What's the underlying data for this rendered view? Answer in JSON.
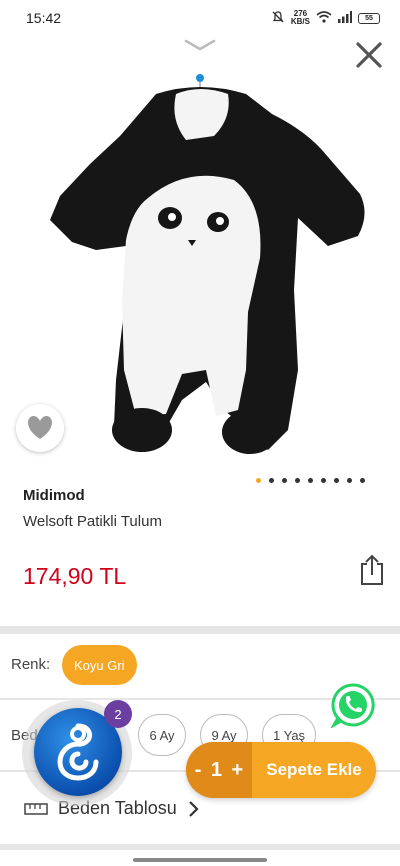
{
  "status_bar": {
    "time": "15:42",
    "net_speed_value": "276",
    "net_speed_unit": "KB/S",
    "battery": "55"
  },
  "product": {
    "brand": "Midimod",
    "name": "Welsoft Patikli Tulum",
    "price": "174,90 TL",
    "image_count": 9,
    "active_image_index": 0
  },
  "options": {
    "color_label": "Renk:",
    "color_value": "Koyu Gri",
    "size_label": "Beden:",
    "sizes": [
      "6 Ay",
      "9 Ay",
      "1 Yaş"
    ]
  },
  "size_table": {
    "label": "Beden Tablosu"
  },
  "cart": {
    "minus": "-",
    "quantity": "1",
    "plus": "+",
    "add_label": "Sepete Ekle"
  },
  "chat": {
    "badge_count": "2"
  },
  "colors": {
    "accent": "#f5a623",
    "accent_dark": "#e08a1a",
    "price": "#d0021b",
    "whatsapp": "#25d366",
    "chat_blue": "#0b4fae",
    "badge": "#6a3fa0"
  }
}
